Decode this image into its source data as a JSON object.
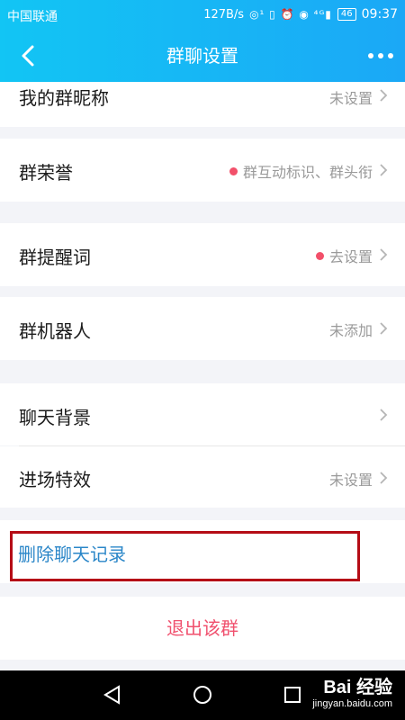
{
  "status_bar": {
    "carrier": "中国联通",
    "speed": "127B/s",
    "icons_text": "◎¹ ▯ ⏰ ◉ ⁴ᴳ▮",
    "battery": "46",
    "time": "09:37"
  },
  "nav": {
    "title": "群聊设置",
    "back_icon": "chevron-left-icon",
    "more_icon": "more-dots-icon"
  },
  "settings": {
    "my_nickname": {
      "label": "我的群昵称",
      "value": "未设置"
    },
    "group_honor": {
      "label": "群荣誉",
      "value": "群互动标识、群头衔"
    },
    "group_prompt": {
      "label": "群提醒词",
      "value": "去设置"
    },
    "group_robot": {
      "label": "群机器人",
      "value": "未添加"
    },
    "chat_background": {
      "label": "聊天背景",
      "value": ""
    },
    "entry_effect": {
      "label": "进场特效",
      "value": "未设置"
    }
  },
  "actions": {
    "delete_history": "删除聊天记录",
    "exit_group": "退出该群"
  },
  "colors": {
    "header_start": "#12c5f4",
    "header_end": "#1ba8f6",
    "highlight_border": "#b50c16",
    "delete_text": "#2a86c8",
    "exit_text": "#f0506e",
    "red_dot": "#f2506a"
  },
  "watermark": {
    "main": "Bai 经验",
    "sub": "jingyan.baidu.com"
  }
}
